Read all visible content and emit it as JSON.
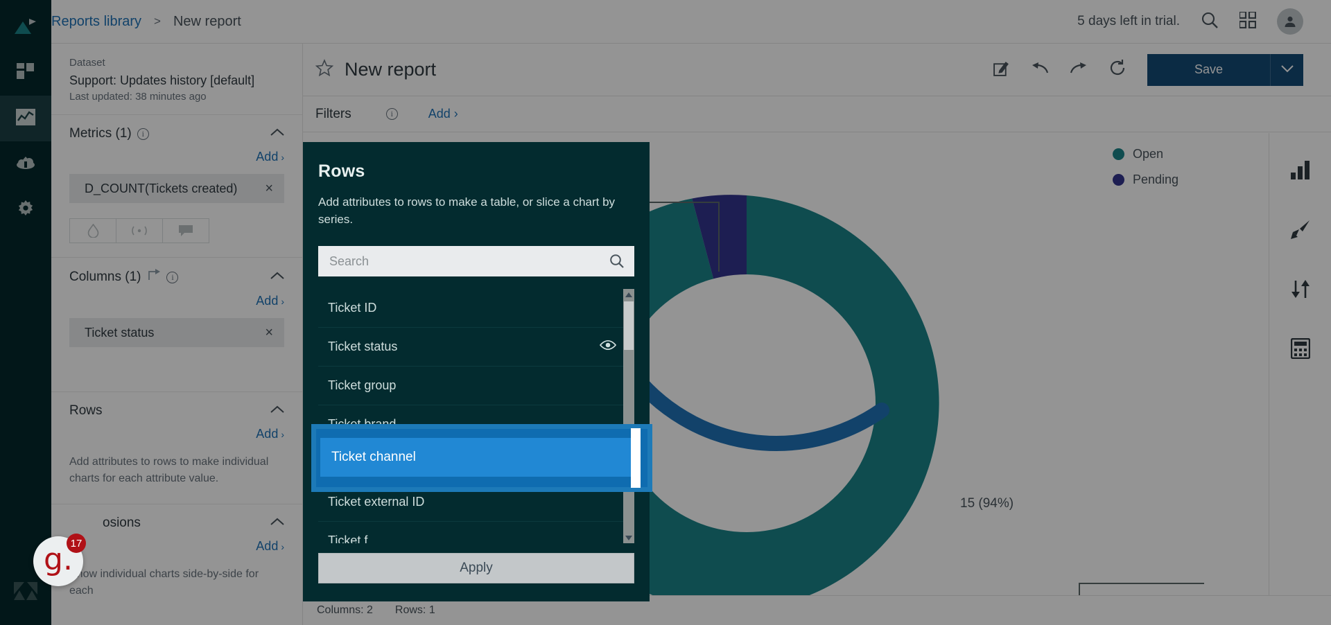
{
  "rail": {
    "items": [
      {
        "name": "logo",
        "icon": "explore-logo-icon"
      },
      {
        "name": "dashboards",
        "icon": "dashboard-grid-icon"
      },
      {
        "name": "reports",
        "icon": "line-chart-icon",
        "active": true
      },
      {
        "name": "datasets",
        "icon": "cloud-upload-icon"
      },
      {
        "name": "settings",
        "icon": "gear-icon"
      }
    ],
    "bottom_logo": "zendesk-logo-icon"
  },
  "topbar": {
    "breadcrumb_root": "Reports library",
    "breadcrumb_sep": ">",
    "breadcrumb_current": "New report",
    "trial_text": "5 days left in trial.",
    "search_icon": "search-icon",
    "apps_icon": "apps-grid-icon",
    "avatar_icon": "user-avatar-icon"
  },
  "subheader": {
    "star_icon": "star-outline-icon",
    "report_title": "New report",
    "edit_icon": "edit-pencil-icon",
    "undo_icon": "undo-arrow-icon",
    "redo_icon": "redo-arrow-icon",
    "refresh_icon": "refresh-icon",
    "save_label": "Save",
    "save_caret_icon": "chevron-down-icon"
  },
  "dataset": {
    "label": "Dataset",
    "name": "Support: Updates history [default]",
    "updated": "Last updated: 38 minutes ago"
  },
  "panel": {
    "metrics": {
      "title": "Metrics (1)",
      "add_label": "Add",
      "chips": [
        {
          "label": "D_COUNT(Tickets created)",
          "remove_icon": "close-x-icon"
        }
      ],
      "mini_buttons": [
        {
          "icon": "filter-drop-icon"
        },
        {
          "icon": "broadcast-icon"
        },
        {
          "icon": "comment-icon"
        }
      ]
    },
    "columns": {
      "title": "Columns (1)",
      "swap_icon": "swap-axis-icon",
      "add_label": "Add",
      "chips": [
        {
          "label": "Ticket status",
          "remove_icon": "close-x-icon"
        }
      ]
    },
    "rows": {
      "title": "Rows",
      "add_label": "Add",
      "hint": "Add attributes to rows to make individual charts for each attribute value."
    },
    "explosions": {
      "title": "Explosions",
      "title_visible": "osions",
      "add_label": "Add",
      "hint": "Show individual charts side-by-side for each"
    },
    "caret_icon": "chevron-up-icon",
    "info_icon": "info-circle-icon",
    "add_chevron": "›"
  },
  "filters": {
    "label": "Filters",
    "info_icon": "info-circle-icon",
    "add_label": "Add"
  },
  "toolrail": {
    "items": [
      {
        "icon": "bar-chart-icon",
        "name": "chart-type-button"
      },
      {
        "icon": "paint-brush-icon",
        "name": "chart-style-button"
      },
      {
        "icon": "sort-updown-icon",
        "name": "result-manipulation-button"
      },
      {
        "icon": "calculator-icon",
        "name": "calculations-button"
      }
    ]
  },
  "statusbar": {
    "columns_text": "Columns: 2",
    "rows_text": "Rows: 1"
  },
  "modal": {
    "title": "Rows",
    "description": "Add attributes to rows to make a table, or slice a chart by series.",
    "search_placeholder": "Search",
    "search_value": "",
    "search_icon": "search-icon",
    "items": [
      {
        "label": "Ticket ID",
        "icon": ""
      },
      {
        "label": "Ticket status",
        "icon": "eye-icon"
      },
      {
        "label": "Ticket group",
        "icon": ""
      },
      {
        "label": "Ticket brand",
        "icon": ""
      },
      {
        "label": "Ticket channel",
        "icon": "",
        "highlighted": true
      },
      {
        "label": "Ticket external ID",
        "icon": ""
      },
      {
        "label": "Ticket f",
        "icon": ""
      }
    ],
    "apply_label": "Apply",
    "scroll_up_icon": "scroll-up-arrow-icon",
    "scroll_down_icon": "scroll-down-arrow-icon"
  },
  "highlight": {
    "label": "Ticket channel",
    "border_color": "#1d7ab8",
    "fill_color": "#2188d4"
  },
  "chat": {
    "logo_text": "g.",
    "badge_count": "17"
  },
  "chart_data": {
    "type": "pie",
    "title": "",
    "categories": [
      "Open",
      "Pending"
    ],
    "values": [
      15,
      1
    ],
    "labels": [
      "15 (94%)",
      ""
    ],
    "percentages": [
      94,
      6
    ],
    "colors": [
      "#1b8489",
      "#33348e"
    ],
    "legend": [
      {
        "label": "Open",
        "color": "#1b8489"
      },
      {
        "label": "Pending",
        "color": "#33348e"
      }
    ],
    "legend_position": "top-right",
    "donut": true,
    "inner_radius_ratio": 0.62,
    "annotations": [
      "15 (94%)"
    ]
  }
}
